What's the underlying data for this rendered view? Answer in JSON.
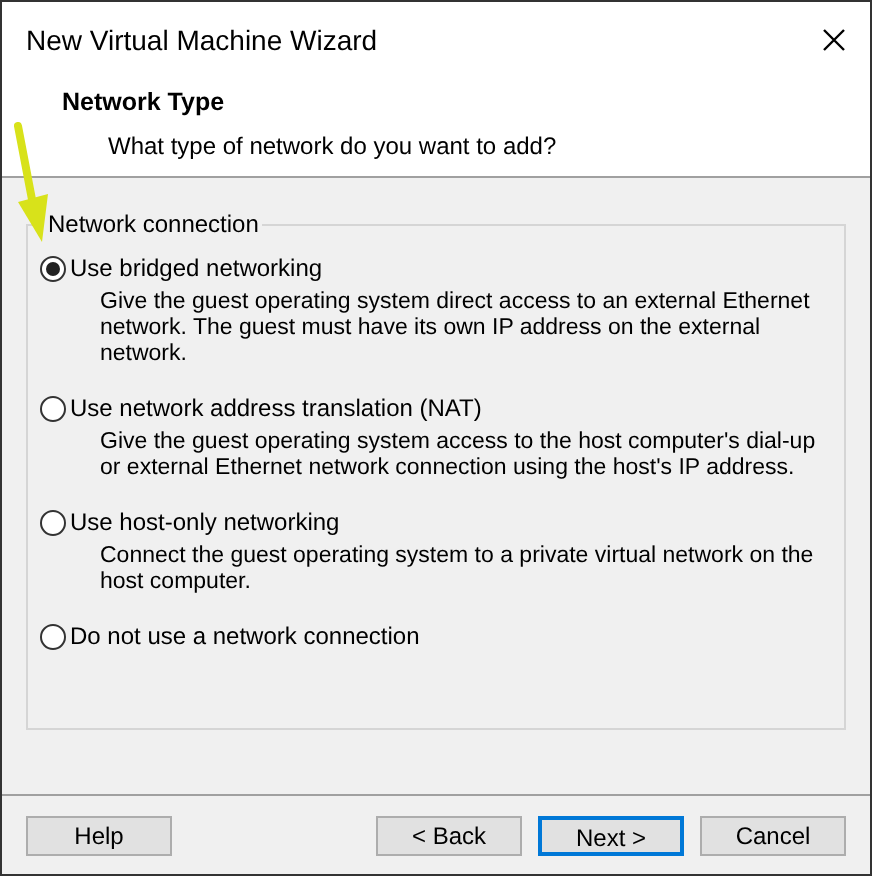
{
  "window": {
    "title": "New Virtual Machine Wizard"
  },
  "header": {
    "title": "Network Type",
    "subtitle": "What type of network do you want to add?"
  },
  "group": {
    "label": "Network connection",
    "options": [
      {
        "label": "Use bridged networking",
        "description": "Give the guest operating system direct access to an external Ethernet network. The guest must have its own IP address on the external network.",
        "selected": true
      },
      {
        "label": "Use network address translation (NAT)",
        "description": "Give the guest operating system access to the host computer's dial-up or external Ethernet network connection using the host's IP address.",
        "selected": false
      },
      {
        "label": "Use host-only networking",
        "description": "Connect the guest operating system to a private virtual network on the host computer.",
        "selected": false
      },
      {
        "label": "Do not use a network connection",
        "selected": false
      }
    ]
  },
  "buttons": [
    {
      "label": "Help",
      "kind": "help"
    },
    {
      "label": "< Back",
      "kind": "nav"
    },
    {
      "label": "Next >",
      "kind": "default"
    },
    {
      "label": "Cancel",
      "kind": "nav"
    }
  ]
}
